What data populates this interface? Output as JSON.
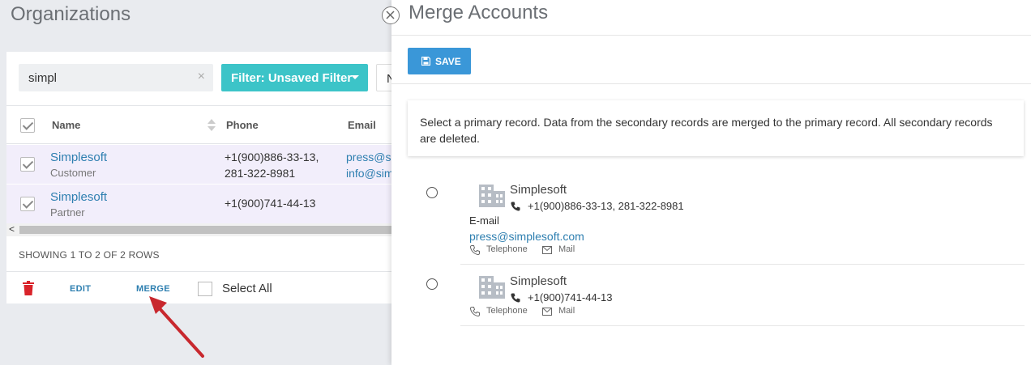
{
  "organizations": {
    "title": "Organizations",
    "search": {
      "value": "simpl",
      "clear_glyph": "×"
    },
    "filter_button": "Filter: Unsaved Filter",
    "next_button_partial": "N",
    "columns": {
      "name": "Name",
      "phone": "Phone",
      "email": "Email"
    },
    "rows": [
      {
        "name": "Simplesoft",
        "type": "Customer",
        "phone_line1": "+1(900)886-33-13,",
        "phone_line2": "281-322-8981",
        "email_line1": "press@s",
        "email_line2": "info@sim"
      },
      {
        "name": "Simplesoft",
        "type": "Partner",
        "phone_line1": "+1(900)741-44-13",
        "phone_line2": "",
        "email_line1": "",
        "email_line2": ""
      }
    ],
    "scroll_left_glyph": "<",
    "showing": "SHOWING 1 TO 2 OF 2 ROWS",
    "footer": {
      "edit": "EDIT",
      "merge": "MERGE",
      "select_all": "Select All"
    }
  },
  "merge_panel": {
    "title": "Merge Accounts",
    "save_button": "SAVE",
    "info_text": "Select a primary record. Data from the secondary records are merged to the primary record. All secondary records are deleted.",
    "records": [
      {
        "name": "Simplesoft",
        "phone": "+1(900)886-33-13, 281-322-8981",
        "email_label": "E-mail",
        "email": "press@simplesoft.com",
        "channels": {
          "telephone": "Telephone",
          "mail": "Mail"
        }
      },
      {
        "name": "Simplesoft",
        "phone": "+1(900)741-44-13",
        "channels": {
          "telephone": "Telephone",
          "mail": "Mail"
        }
      }
    ]
  },
  "colors": {
    "filter_teal": "#3cc4c8",
    "save_blue": "#3a97d8",
    "link_blue": "#2e7fb0",
    "trash_red": "#d9232a",
    "arrow_red": "#c8282e",
    "selected_row": "#f2eefb"
  },
  "icons": [
    "search-clear-icon",
    "filter-caret-icon",
    "sort-icon",
    "trash-icon",
    "close-icon",
    "save-icon",
    "building-icon",
    "phone-icon",
    "mail-icon",
    "annotation-arrow-icon"
  ]
}
